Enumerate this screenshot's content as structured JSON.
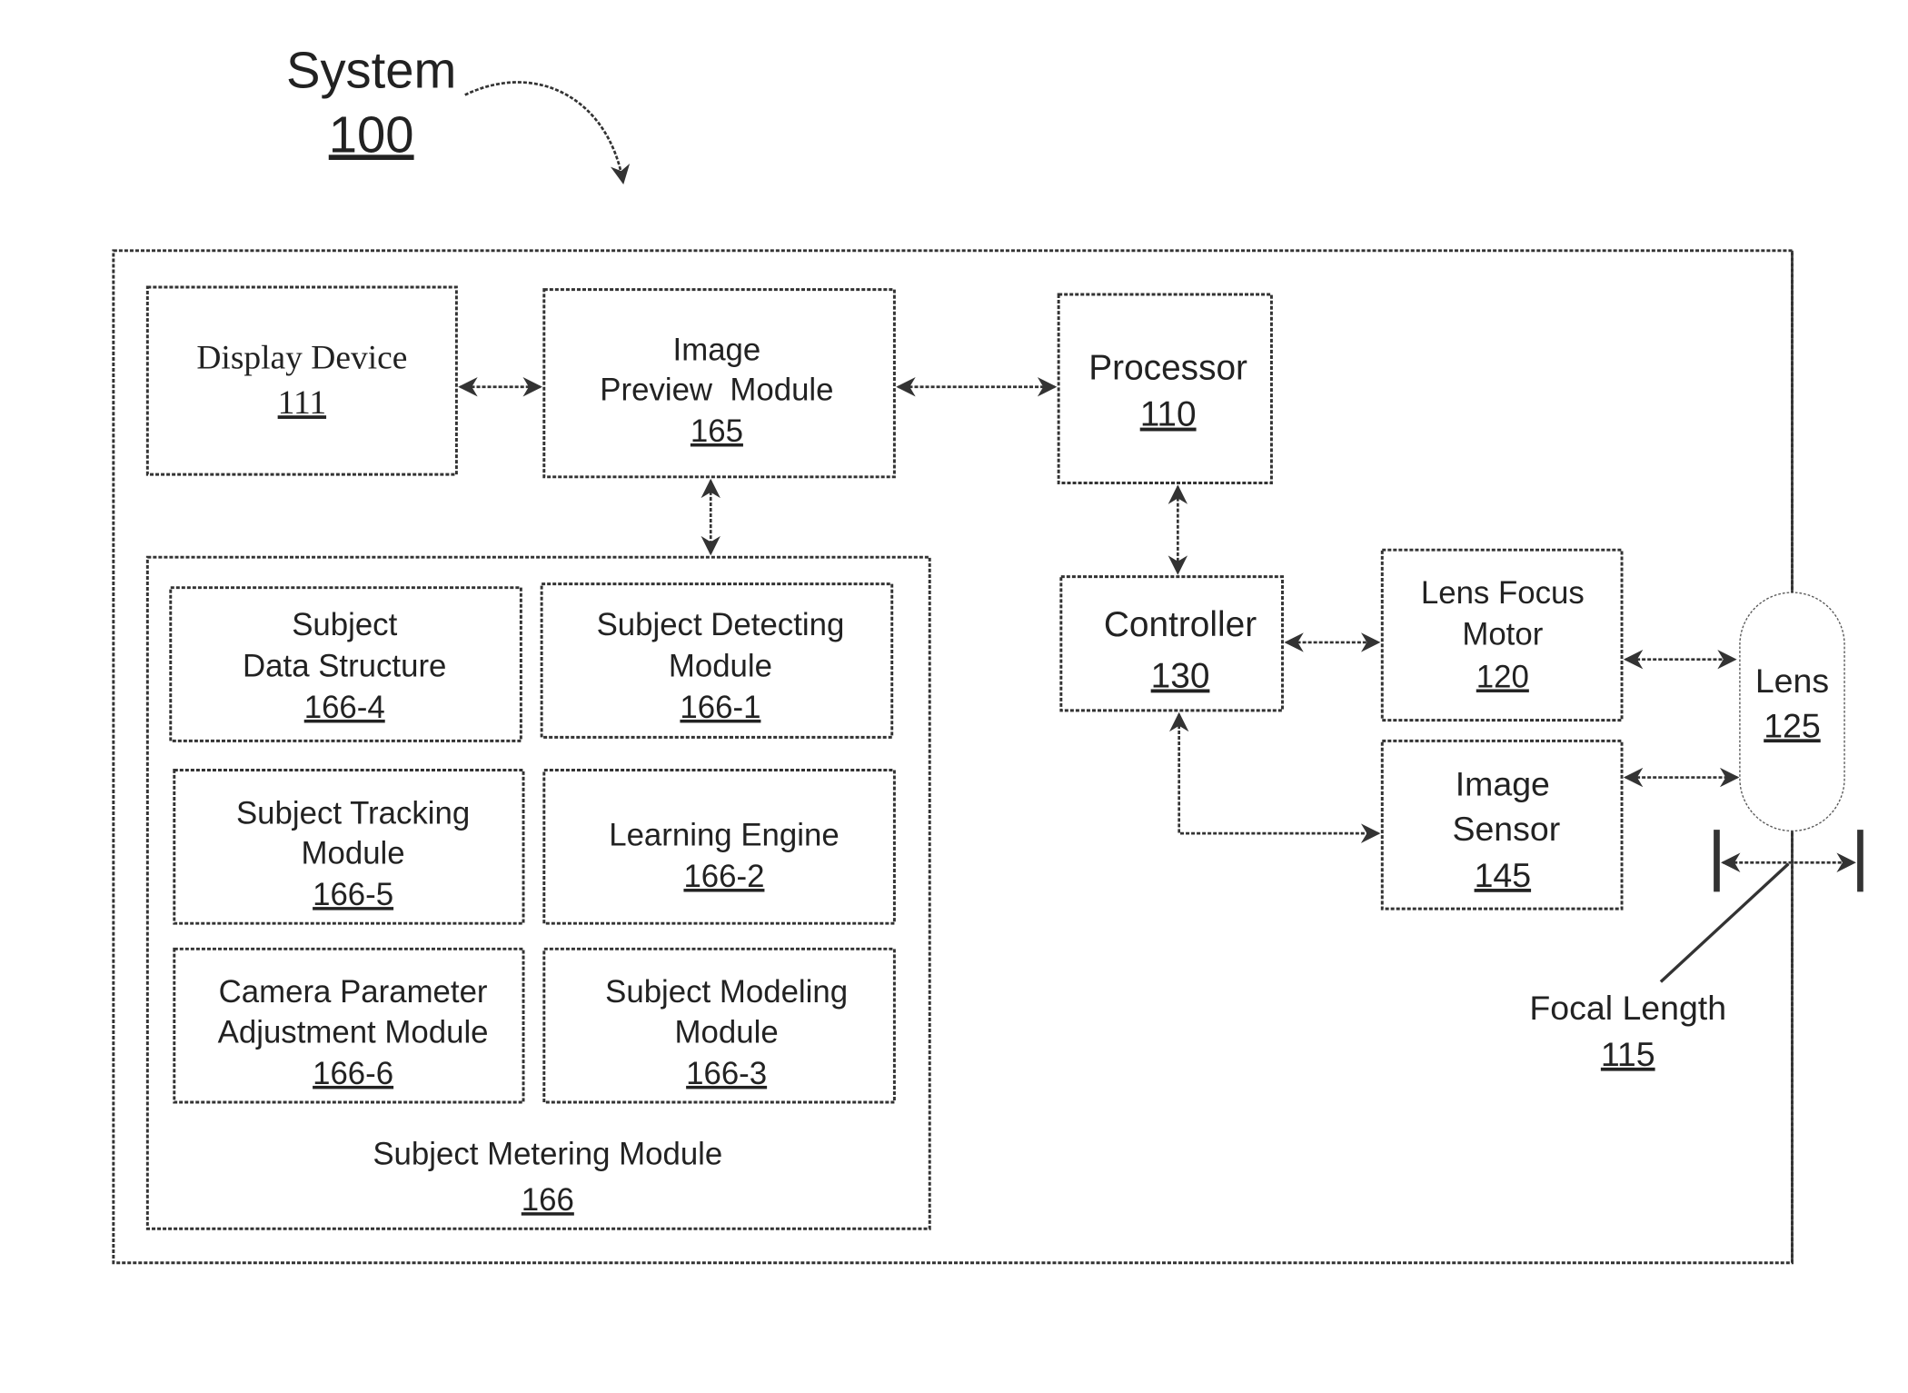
{
  "title": {
    "name": "System",
    "number": "100"
  },
  "blocks": {
    "display_device": {
      "lines": [
        "Display Device"
      ],
      "number": "111"
    },
    "image_preview": {
      "lines": [
        "Image",
        "Preview  Module"
      ],
      "number": "165"
    },
    "processor": {
      "lines": [
        "Processor"
      ],
      "number": "110"
    },
    "controller": {
      "lines": [
        "Controller"
      ],
      "number": "130"
    },
    "lens_focus_motor": {
      "lines": [
        "Lens Focus",
        "Motor"
      ],
      "number": "120"
    },
    "image_sensor": {
      "lines": [
        "Image",
        "Sensor"
      ],
      "number": "145"
    },
    "lens": {
      "lines": [
        "Lens"
      ],
      "number": "125"
    },
    "focal_length": {
      "lines": [
        "Focal Length"
      ],
      "number": "115"
    },
    "subject_metering": {
      "lines": [
        "Subject Metering Module"
      ],
      "number": "166"
    },
    "subject_data_structure": {
      "lines": [
        "Subject",
        "Data Structure"
      ],
      "number": "166-4"
    },
    "subject_detecting": {
      "lines": [
        "Subject Detecting",
        "Module"
      ],
      "number": "166-1"
    },
    "subject_tracking": {
      "lines": [
        "Subject Tracking",
        "Module"
      ],
      "number": "166-5"
    },
    "learning_engine": {
      "lines": [
        "Learning Engine"
      ],
      "number": "166-2"
    },
    "camera_param": {
      "lines": [
        "Camera Parameter",
        "Adjustment Module"
      ],
      "number": "166-6"
    },
    "subject_modeling": {
      "lines": [
        "Subject Modeling",
        "Module"
      ],
      "number": "166-3"
    }
  }
}
